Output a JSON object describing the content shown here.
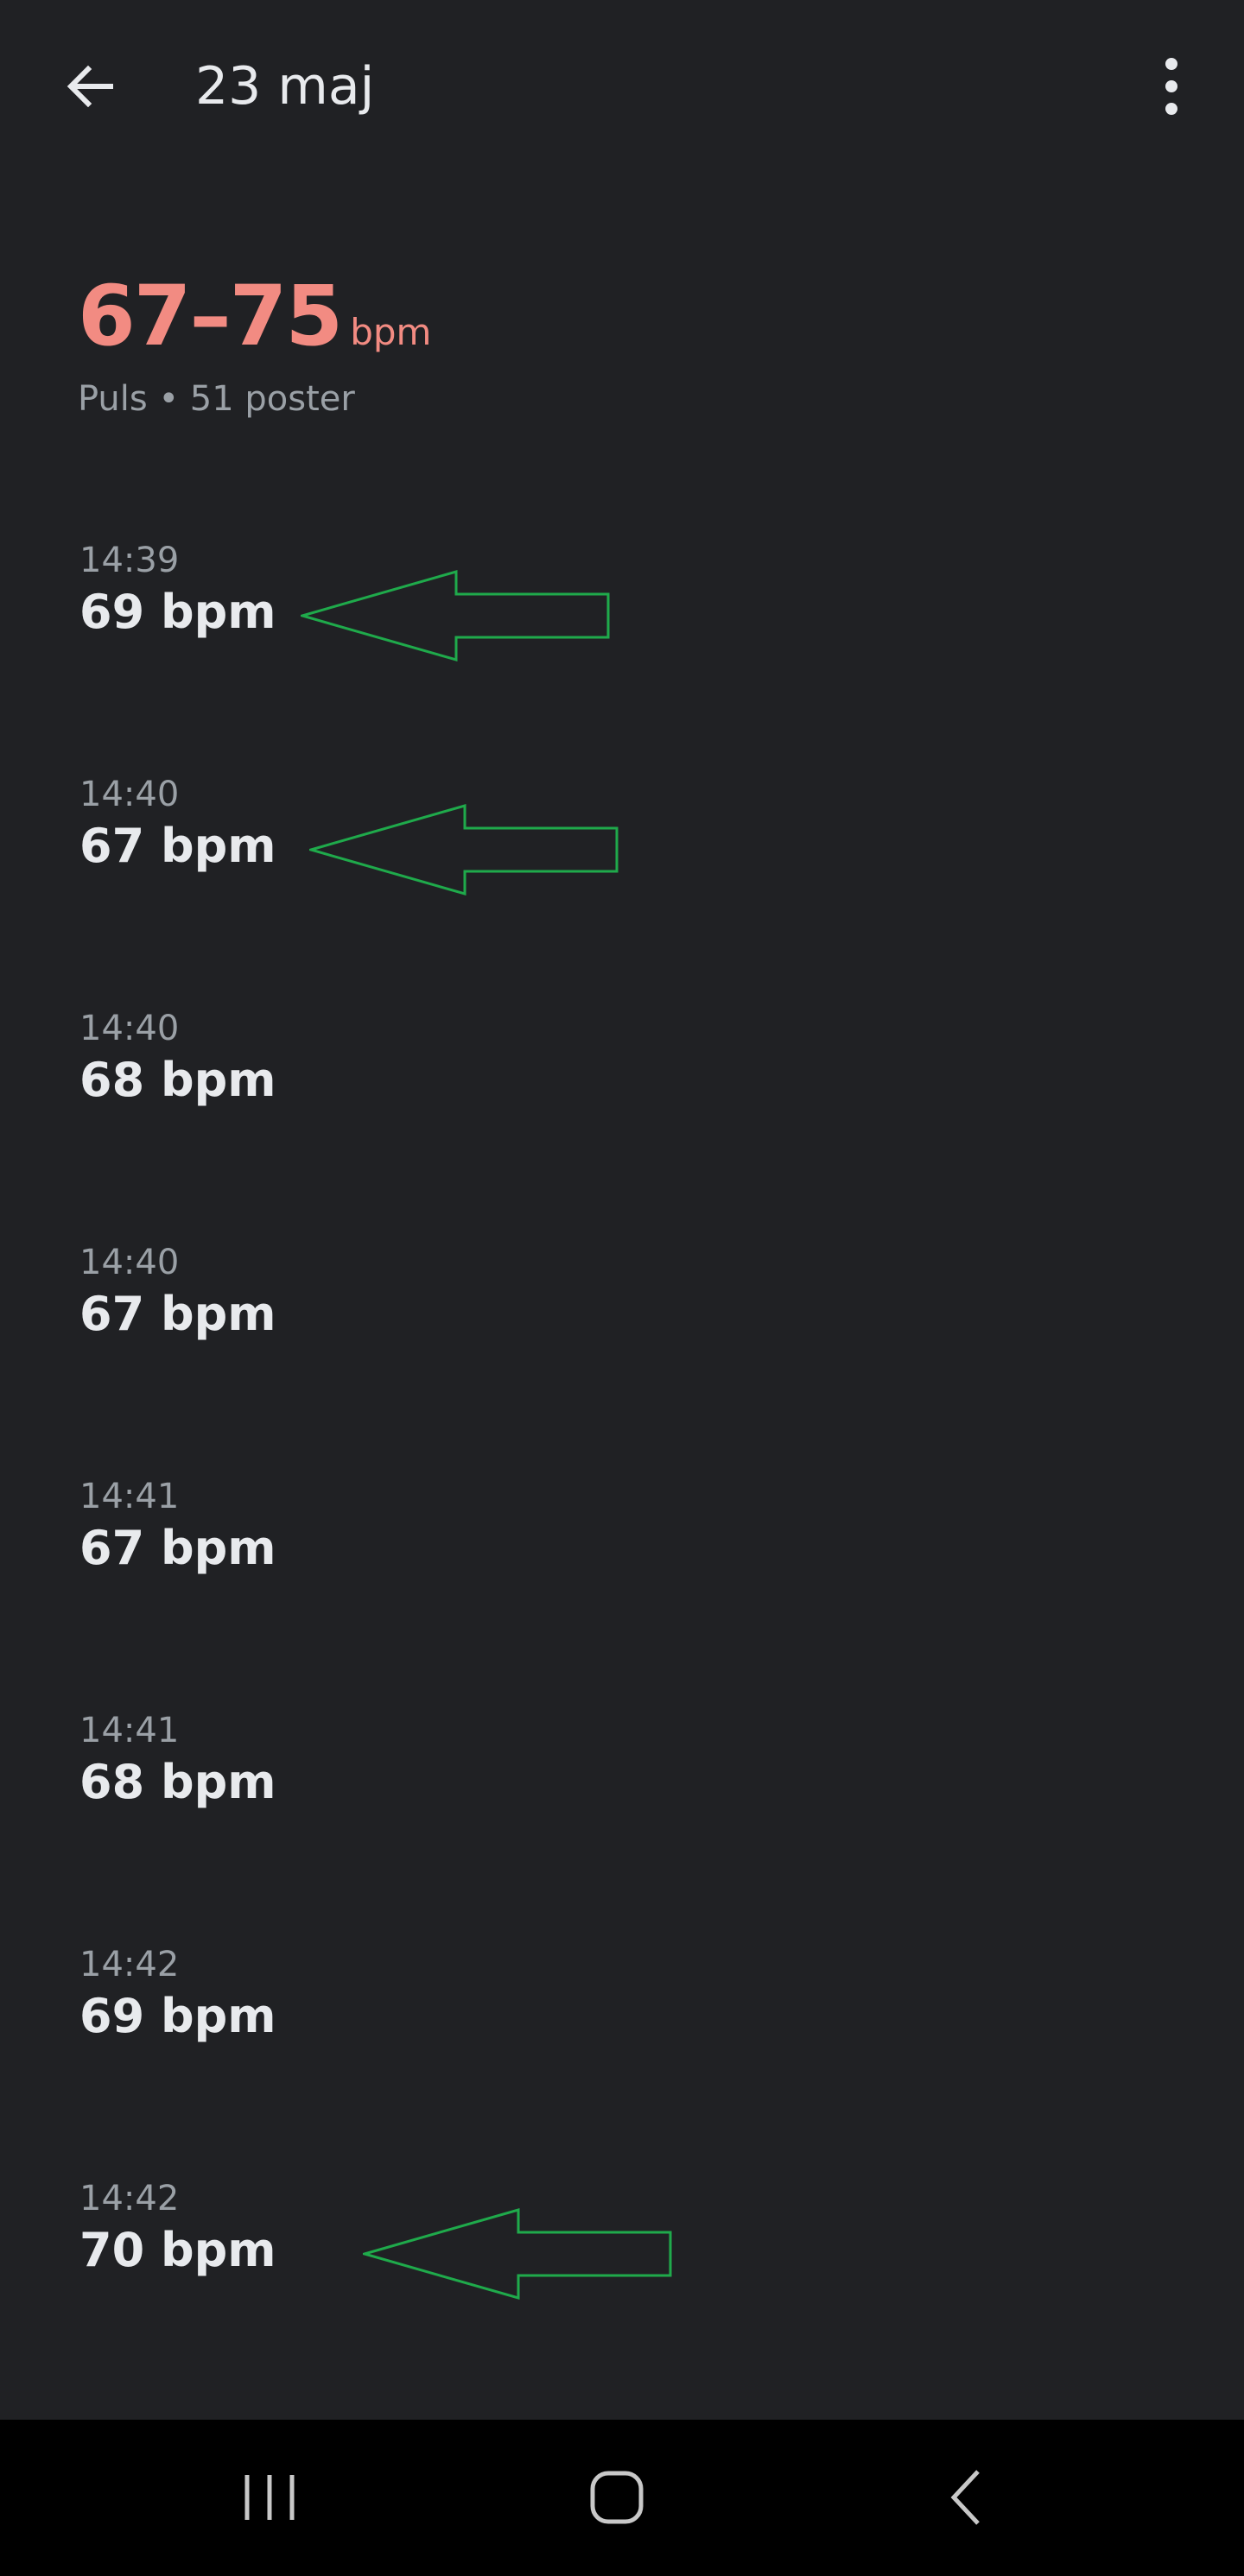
{
  "app_bar": {
    "title": "23 maj",
    "back_icon": "arrow-left-icon",
    "menu_icon": "more-vertical-icon"
  },
  "summary": {
    "range": "67–75",
    "unit": "bpm",
    "subtitle": "Puls • 51 poster",
    "accent_color": "#f28b82"
  },
  "readings": [
    {
      "time": "14:39",
      "value": "69 bpm",
      "annotated": true
    },
    {
      "time": "14:40",
      "value": "67 bpm",
      "annotated": true
    },
    {
      "time": "14:40",
      "value": "68 bpm",
      "annotated": false
    },
    {
      "time": "14:40",
      "value": "67 bpm",
      "annotated": false
    },
    {
      "time": "14:41",
      "value": "67 bpm",
      "annotated": false
    },
    {
      "time": "14:41",
      "value": "68 bpm",
      "annotated": false
    },
    {
      "time": "14:42",
      "value": "69 bpm",
      "annotated": false
    },
    {
      "time": "14:42",
      "value": "70 bpm",
      "annotated": true
    }
  ],
  "annotation": {
    "icon": "left-arrow-outline-icon",
    "color": "#1faa4b"
  },
  "nav_bar": {
    "recents_icon": "recents-icon",
    "home_icon": "home-icon",
    "back_icon": "chevron-left-icon"
  }
}
